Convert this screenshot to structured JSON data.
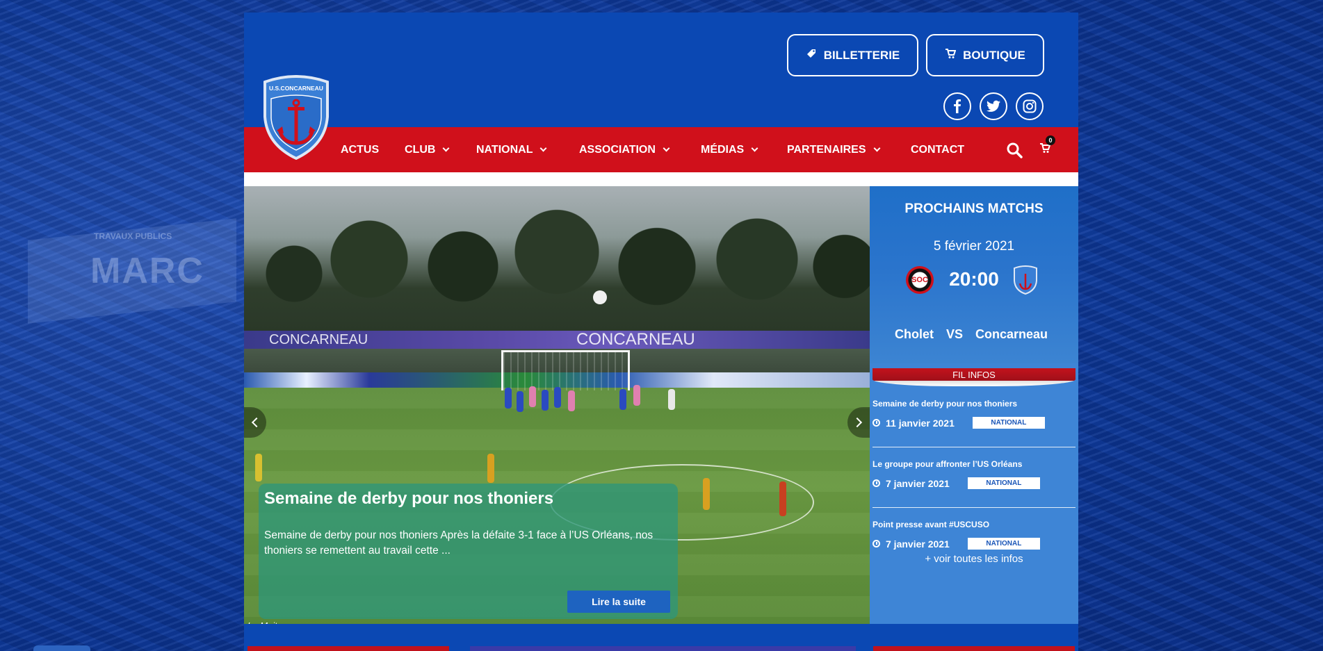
{
  "header": {
    "billetterie_label": "BILLETTERIE",
    "boutique_label": "BOUTIQUE",
    "logo_text": "U.S.CONCARNEAU"
  },
  "nav": {
    "items": [
      {
        "label": "ACTUS",
        "dropdown": false
      },
      {
        "label": "CLUB",
        "dropdown": true
      },
      {
        "label": "NATIONAL",
        "dropdown": true
      },
      {
        "label": "ASSOCIATION",
        "dropdown": true
      },
      {
        "label": "MÉDIAS",
        "dropdown": true
      },
      {
        "label": "PARTENAIRES",
        "dropdown": true
      },
      {
        "label": "CONTACT",
        "dropdown": false
      }
    ],
    "cart_count": "0"
  },
  "hero": {
    "title": "Semaine de derby pour nos thoniers",
    "excerpt": "Semaine de derby pour nos thoniers Après la défaite 3-1 face à l’US Orléans, nos thoniers se remettent au travail cette ...",
    "read_more": "Lire la suite",
    "photo_credit": "Le Maitre",
    "stadium_banner_left": "CONCARNEAU",
    "stadium_banner_center": "CONCARNEAU"
  },
  "sidebar": {
    "title": "PROCHAINS MATCHS",
    "match": {
      "date": "5 février 2021",
      "time": "20:00",
      "home": "Cholet",
      "vs": "VS",
      "away": "Concarneau",
      "home_badge": "SOC"
    },
    "fil_infos_label": "FIL INFOS",
    "news": [
      {
        "title": "Semaine de derby pour nos thoniers",
        "date": "11 janvier 2021",
        "tag": "NATIONAL"
      },
      {
        "title": "Le groupe pour affronter l’US Orléans",
        "date": "7 janvier 2021",
        "tag": "NATIONAL"
      },
      {
        "title": "Point presse avant #USCUSO",
        "date": "7 janvier 2021",
        "tag": "NATIONAL"
      }
    ],
    "see_all": "+ voir toutes les infos"
  },
  "background": {
    "sign_small": "TRAVAUX PUBLICS",
    "sign_big": "MARC"
  },
  "colors": {
    "brand_blue": "#0b48b3",
    "nav_red": "#d0101b",
    "sidebar_blue": "#3e85d6"
  }
}
